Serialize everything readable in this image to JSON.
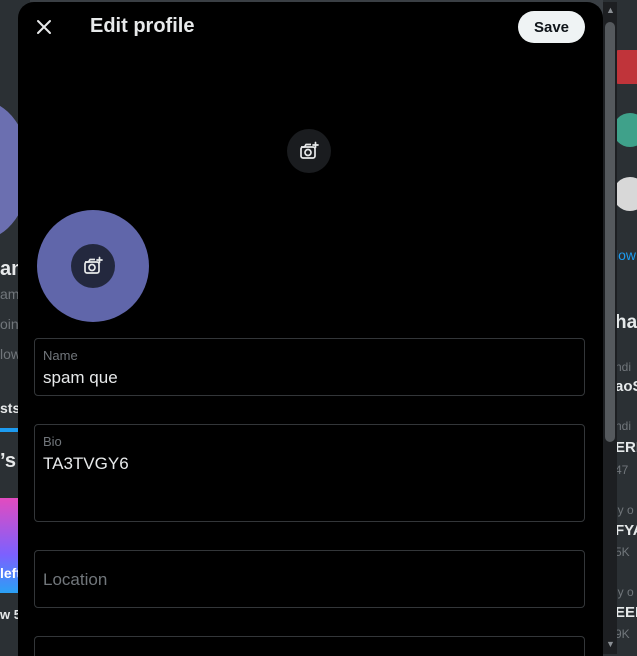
{
  "modal": {
    "title": "Edit profile",
    "save_label": "Save"
  },
  "icons": {
    "close": "close-icon",
    "banner_camera": "add-photo-icon",
    "avatar_camera": "add-photo-icon"
  },
  "fields": {
    "name": {
      "label": "Name",
      "value": "spam que"
    },
    "bio": {
      "label": "Bio",
      "value": "TA3TVGY6"
    },
    "location": {
      "placeholder": "Location"
    }
  },
  "background_left": {
    "name_fragment": "am",
    "handle_fragment": "am",
    "line1": "oin",
    "line2": "low",
    "tab": "sts",
    "heading": "’s",
    "card_text": "left",
    "footer": "w 5"
  },
  "background_right": {
    "follow_link": "low",
    "heading": "ha",
    "items": [
      {
        "small": "ndi",
        "bold": "aoS"
      },
      {
        "small": "ndi",
        "bold": "ERR",
        "count": "47"
      },
      {
        "small": "ly o",
        "bold": "FYA",
        "count": "5K"
      },
      {
        "small": "ly o",
        "bold": "EER",
        "count": "9K"
      }
    ]
  },
  "colors": {
    "modal_bg": "#000000",
    "avatar": "#6066aa",
    "accent": "#1d9bf0"
  }
}
